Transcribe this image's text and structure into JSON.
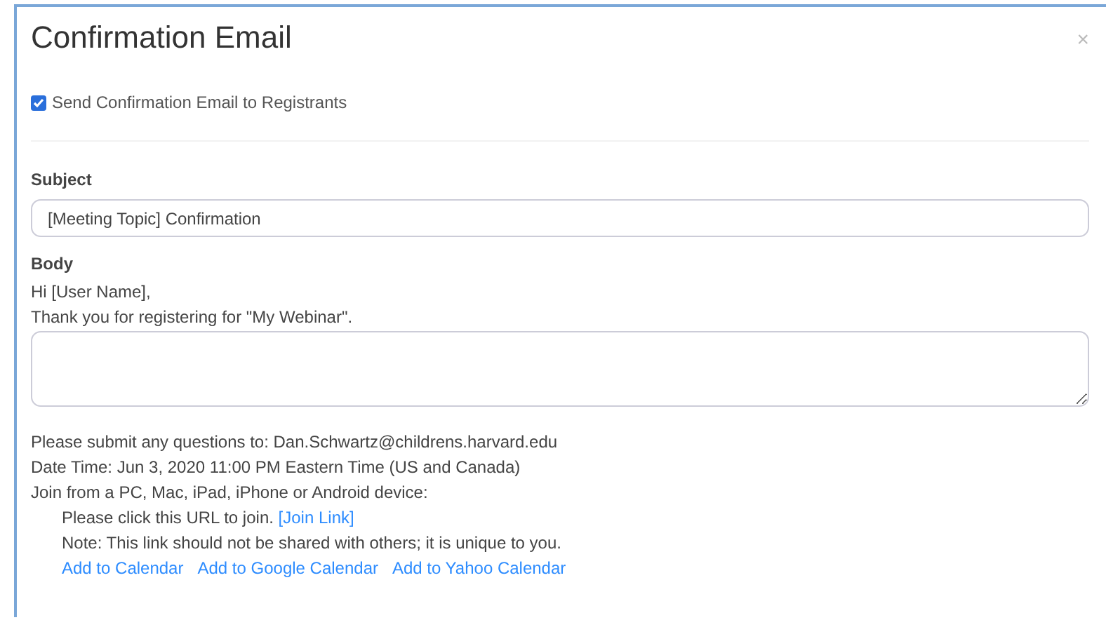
{
  "dialog": {
    "title": "Confirmation Email",
    "close": "×"
  },
  "send_confirmation": {
    "label": "Send Confirmation Email to Registrants",
    "checked": true
  },
  "subject": {
    "label": "Subject",
    "value": "[Meeting Topic] Confirmation"
  },
  "body": {
    "label": "Body",
    "intro": [
      "Hi [User Name],",
      "Thank you for registering for \"My Webinar\"."
    ],
    "details": [
      {
        "text": "Please submit any questions to: Dan.Schwartz@childrens.harvard.edu",
        "indented": false
      },
      {
        "text": "Date Time: Jun 3, 2020 11:00 PM Eastern Time (US and Canada)",
        "indented": false
      },
      {
        "text": "Join from a PC, Mac, iPad, iPhone or Android device:",
        "indented": false
      },
      {
        "text": "Please click this URL to join.",
        "link": "[Join Link]",
        "indented": true
      },
      {
        "text": "Note: This link should not be shared with others; it is unique to you.",
        "indented": true
      }
    ],
    "calendar_links": [
      "Add to Calendar",
      "Add to Google Calendar",
      "Add to Yahoo Calendar"
    ]
  }
}
